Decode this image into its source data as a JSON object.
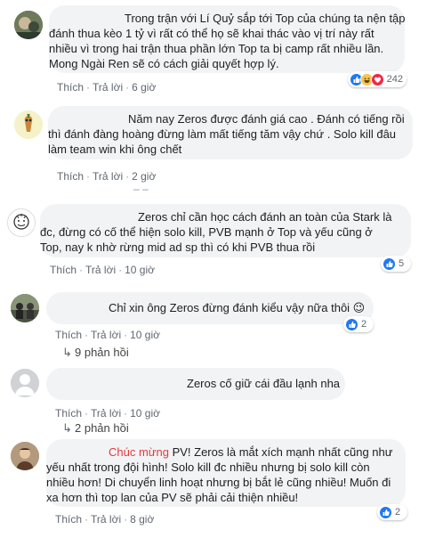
{
  "comments": [
    {
      "lines": [
        "Trong trận với Lí Quỷ sắp tới Top của chúng ta nện tập",
        "đánh thua kèo 1 tỷ vì rất có thể họ sẽ khai thác vào vị trí này rất",
        "nhiều vì trong hai trận thua phần lớn Top ta bị camp rất nhiều lần.",
        "Mong Ngài Ren sẽ có cách giải quyết hợp lý."
      ],
      "like": "Thích",
      "reply": "Trả lời",
      "time": "6 giờ",
      "reaction_count": "242",
      "reactions": [
        "like-icon",
        "haha-icon",
        "love-icon"
      ]
    },
    {
      "lines": [
        "Năm nay Zeros được đánh giá cao . Đánh có tiếng rồi",
        "thì đánh đàng hoàng đừng làm mất tiếng tăm vậy chứ . Solo kill đâu",
        "làm team win khi ông chết"
      ],
      "like": "Thích",
      "reply": "Trả lời",
      "time": "2 giờ"
    },
    {
      "lines": [
        "Zeros chỉ cần học cách đánh an toàn của Stark là",
        "đc, đừng có cố thể hiện solo kill, PVB mạnh ở Top và yếu cũng ở",
        "Top, nay k nhờ rừng mid ad sp thì có khi PVB thua rồi"
      ],
      "like": "Thích",
      "reply": "Trả lời",
      "time": "10 giờ",
      "reaction_count": "5",
      "reactions": [
        "like-icon"
      ]
    },
    {
      "lines": [
        "Chỉ xin ông Zeros đừng đánh kiểu vậy nữa thôi 😉"
      ],
      "like": "Thích",
      "reply": "Trả lời",
      "time": "10 giờ",
      "reaction_count": "2",
      "reactions": [
        "like-icon"
      ],
      "replies_label": "9 phản hồi"
    },
    {
      "lines": [
        "Zeros cố giữ cái đầu lạnh nha"
      ],
      "like": "Thích",
      "reply": "Trả lời",
      "time": "10 giờ",
      "replies_label": "2 phản hồi"
    },
    {
      "highlight": "Chúc mừng",
      "lines": [
        " PV! Zeros là mắt xích mạnh nhất cũng như",
        "yếu nhất trong đội hình! Solo kill đc nhiều nhưng bị solo kill còn",
        "nhiều hơn! Di chuyển linh hoạt nhưng bị bắt lẻ cũng nhiều! Muốn đi",
        "xa hơn thì top lan của PV sẽ phải cải thiện nhiều!"
      ],
      "like": "Thích",
      "reply": "Trả lời",
      "time": "8 giờ",
      "reaction_count": "2",
      "reactions": [
        "like-icon"
      ]
    }
  ],
  "colors": {
    "bubble": "#f2f3f5",
    "link": "#385898",
    "meta": "#606770",
    "like_blue": "#2078f4",
    "highlight_red": "#e23b3b"
  }
}
